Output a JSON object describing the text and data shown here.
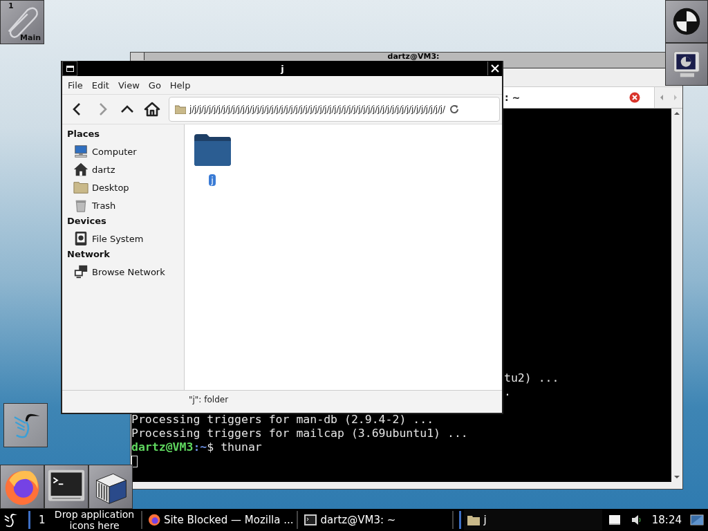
{
  "dock": {
    "workspace": {
      "number": "1",
      "label": "Main"
    }
  },
  "terminal": {
    "title": "dartz@VM3:",
    "tab_label": ": ~",
    "lines": [
      {
        "kind": "partial",
        "text": "tu2) ..."
      },
      {
        "kind": "partial",
        "text": "."
      },
      {
        "kind": "hidden"
      },
      {
        "kind": "output",
        "text": "Processing triggers for man-db (2.9.4-2) ..."
      },
      {
        "kind": "output",
        "text": "Processing triggers for mailcap (3.69ubuntu1) ..."
      },
      {
        "kind": "prompt",
        "user": "dartz@VM3",
        "path": ":~",
        "symbol": "$",
        "command": "thunar"
      },
      {
        "kind": "cursor"
      }
    ]
  },
  "file_manager": {
    "title": "j",
    "menu": [
      "File",
      "Edit",
      "View",
      "Go",
      "Help"
    ],
    "nav": [
      {
        "kind": "back",
        "disabled": false
      },
      {
        "kind": "forward",
        "disabled": true
      },
      {
        "kind": "up",
        "disabled": false
      },
      {
        "kind": "home",
        "disabled": false
      }
    ],
    "location": "j/j/j/j/j/j/j/j/j/j/j/j/j/j/j/j/j/j/j/j/j/j/j/j/j/j/j/j/j/j/j/j/j/j/j/j/j/j/j/j/j/j/j/j/j/j/j/j/j/j/j/j/j/",
    "sidebar": [
      {
        "heading": "Places",
        "items": [
          {
            "label": "Computer",
            "kind": "computer"
          },
          {
            "label": "dartz",
            "kind": "home"
          },
          {
            "label": "Desktop",
            "kind": "desktop"
          },
          {
            "label": "Trash",
            "kind": "trash"
          }
        ]
      },
      {
        "heading": "Devices",
        "items": [
          {
            "label": "File System",
            "kind": "drive"
          }
        ]
      },
      {
        "heading": "Network",
        "items": [
          {
            "label": "Browse Network",
            "kind": "network"
          }
        ]
      }
    ],
    "files": [
      {
        "name": "j",
        "selected": true
      }
    ],
    "status": "\"j\": folder"
  },
  "taskbar": {
    "workspace": "1",
    "drop_hint": "Drop application icons here",
    "tasks": [
      {
        "label": "Site Blocked — Mozilla ...",
        "kind": "browser",
        "selected": false
      },
      {
        "label": "dartz@VM3: ~",
        "kind": "terminal",
        "selected": false
      },
      {
        "label": "j",
        "kind": "folder",
        "selected": true
      }
    ],
    "clock": "18:24"
  }
}
